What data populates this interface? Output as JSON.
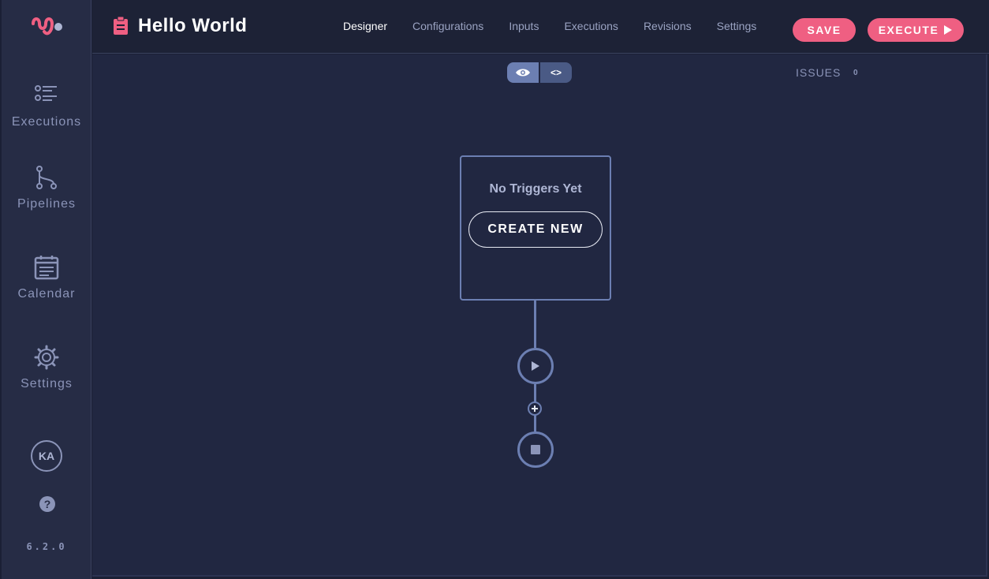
{
  "sidebar": {
    "logo": "tracks-logo",
    "items": [
      {
        "label": "Executions",
        "icon": "list-icon"
      },
      {
        "label": "Pipelines",
        "icon": "pipeline-icon"
      },
      {
        "label": "Calendar",
        "icon": "calendar-icon"
      },
      {
        "label": "Settings",
        "icon": "gear-icon"
      }
    ],
    "avatar_initials": "KA",
    "help_icon": "help-icon",
    "version": "6.2.0"
  },
  "header": {
    "title_icon": "clipboard-icon",
    "title": "Hello World",
    "tabs": [
      {
        "label": "Designer",
        "active": true
      },
      {
        "label": "Configurations",
        "active": false
      },
      {
        "label": "Inputs",
        "active": false
      },
      {
        "label": "Executions",
        "active": false
      },
      {
        "label": "Revisions",
        "active": false
      },
      {
        "label": "Settings",
        "active": false
      }
    ],
    "save_label": "SAVE",
    "execute_label": "EXECUTE"
  },
  "canvas": {
    "view_toggle": {
      "visual_icon": "eye-icon",
      "code_label": "<>"
    },
    "issues_label": "ISSUES",
    "issues_count": "0",
    "trigger": {
      "empty_text": "No Triggers Yet",
      "create_label": "CREATE NEW"
    },
    "nodes": [
      "start-node",
      "add-step",
      "stop-node"
    ]
  },
  "colors": {
    "accent": "#ef5f82",
    "node_border": "#6c7fb2",
    "background": "#212741"
  }
}
